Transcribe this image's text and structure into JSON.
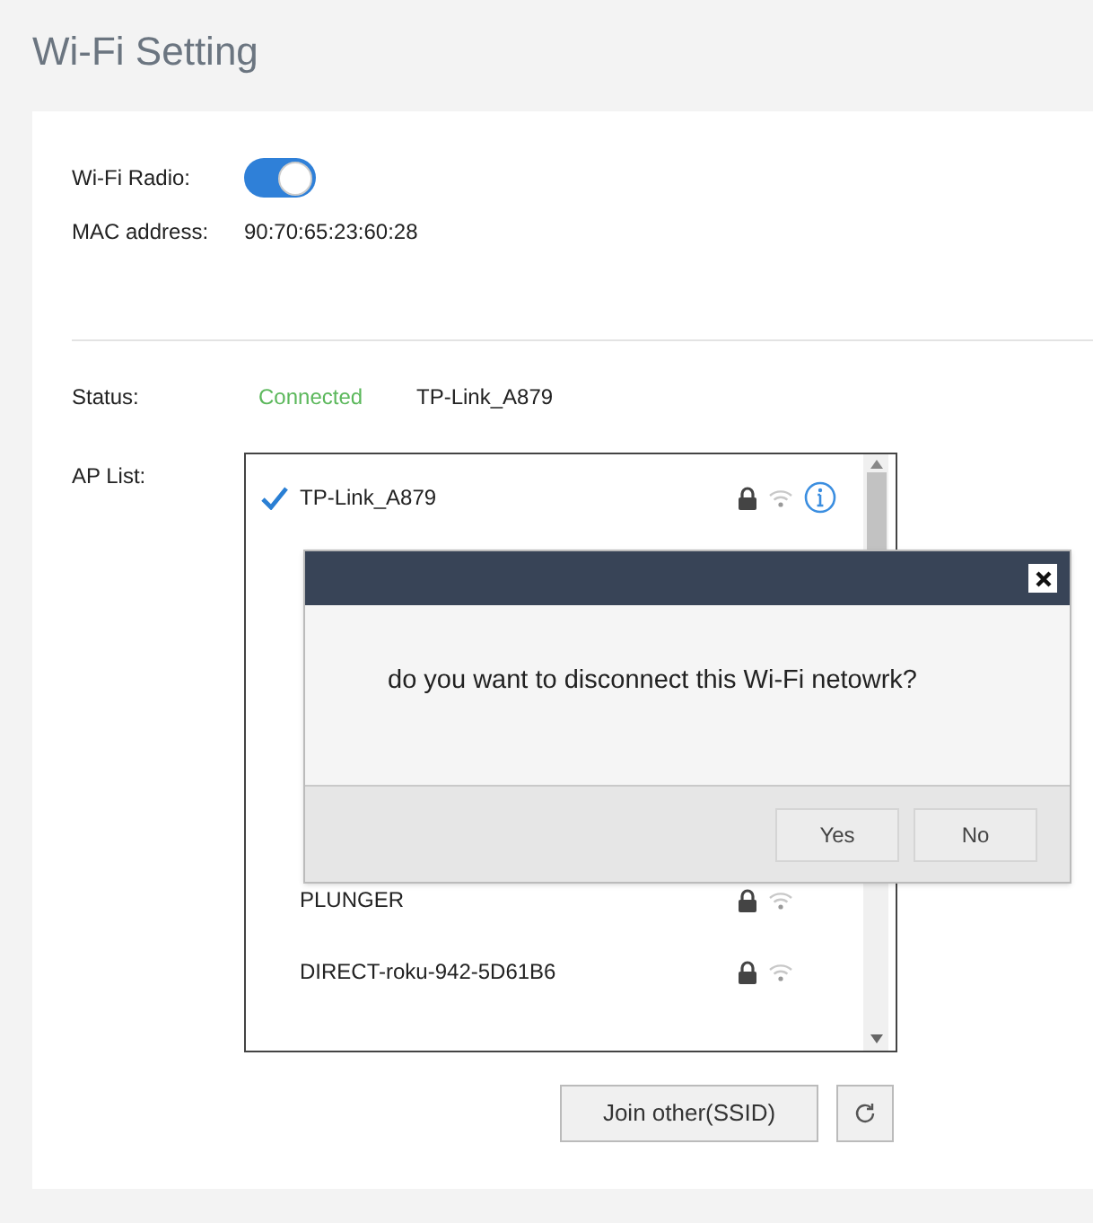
{
  "page_title": "Wi-Fi Setting",
  "wifi_radio": {
    "label": "Wi-Fi Radio:",
    "on": true
  },
  "mac": {
    "label": "MAC address:",
    "value": "90:70:65:23:60:28"
  },
  "status": {
    "label": "Status:",
    "state": "Connected",
    "network": "TP-Link_A879"
  },
  "ap_list": {
    "label": "AP List:",
    "items": [
      {
        "name": "TP-Link_A879",
        "selected": true,
        "locked": true,
        "info": true
      },
      {
        "name": "PLUNGER",
        "selected": false,
        "locked": true,
        "info": false
      },
      {
        "name": "DIRECT-roku-942-5D61B6",
        "selected": false,
        "locked": true,
        "info": false
      }
    ]
  },
  "dialog": {
    "message": "do you want to disconnect this Wi-Fi netowrk?",
    "buttons": [
      "Yes",
      "No"
    ]
  },
  "join_button": "Join other(SSID)"
}
